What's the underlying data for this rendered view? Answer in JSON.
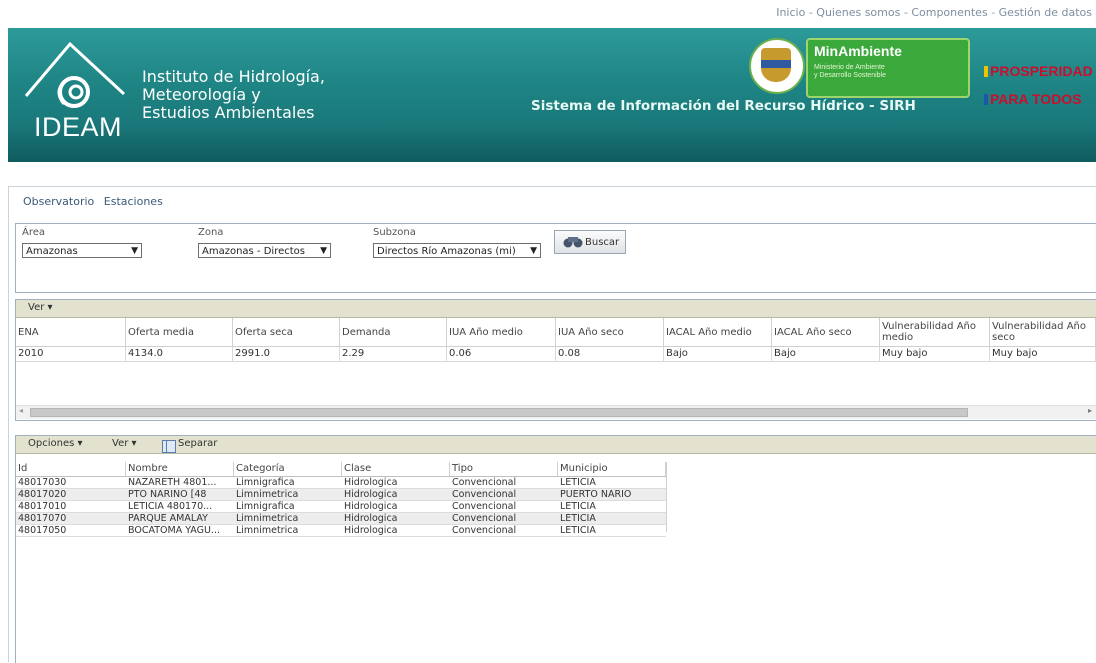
{
  "top_links": [
    "Inicio",
    "Quienes somos",
    "Componentes",
    "Gestión de datos"
  ],
  "banner": {
    "org_abbr": "IDEAM",
    "org_name": "Instituto de Hidrología,\nMeteorología y\nEstudios Ambientales",
    "system_title": "Sistema de Información del Recurso Hídrico - SIRH",
    "ministry_title": "MinAmbiente",
    "ministry_sub": "Ministerio de Ambiente\ny Desarrollo Sostenible",
    "slogan_line1": "PROSPERIDAD",
    "slogan_line2": "PARA TODOS"
  },
  "tabs": [
    "Observatorio",
    "Estaciones"
  ],
  "filters": {
    "area_label": "Área",
    "area_value": "Amazonas",
    "zona_label": "Zona",
    "zona_value": "Amazonas - Directos",
    "subzona_label": "Subzona",
    "subzona_value": "Directos Río Amazonas (mi)",
    "search_label": "Buscar"
  },
  "grid1": {
    "toolbar_ver": "Ver",
    "columns": [
      "ENA",
      "Oferta media",
      "Oferta seca",
      "Demanda",
      "IUA Año medio",
      "IUA Año seco",
      "IACAL Año medio",
      "IACAL Año seco",
      "Vulnerabilidad Año medio",
      "Vulnerabilidad Año seco"
    ],
    "rows": [
      [
        "2010",
        "4134.0",
        "2991.0",
        "2.29",
        "0.06",
        "0.08",
        "Bajo",
        "Bajo",
        "Muy bajo",
        "Muy bajo"
      ]
    ]
  },
  "grid2": {
    "toolbar_opciones": "Opciones",
    "toolbar_ver": "Ver",
    "toolbar_separar": "Separar",
    "columns": [
      "Id",
      "Nombre",
      "Categoría",
      "Clase",
      "Tipo",
      "Municipio"
    ],
    "rows": [
      [
        "48017030",
        "NAZARETH  4801...",
        "Limnigrafica",
        "Hidrologica",
        "Convencional",
        "LETICIA"
      ],
      [
        "48017020",
        "PTO NARIÑO [48",
        "Limnimetrica",
        "Hidrologica",
        "Convencional",
        "PUERTO NARIO"
      ],
      [
        "48017010",
        "LETICIA  480170...",
        "Limnigrafica",
        "Hidrologica",
        "Convencional",
        "LETICIA"
      ],
      [
        "48017070",
        "PARQUE AMALAY",
        "Limnimetrica",
        "Hidrologica",
        "Convencional",
        "LETICIA"
      ],
      [
        "48017050",
        "BOCATOMA YAGU...",
        "Limnimetrica",
        "Hidrologica",
        "Convencional",
        "LETICIA"
      ]
    ]
  },
  "colors": {
    "banner": "#1f8585",
    "toolbar": "#e2e2cf",
    "ministry": "#3aa83a",
    "slogan": "#c8102e"
  }
}
